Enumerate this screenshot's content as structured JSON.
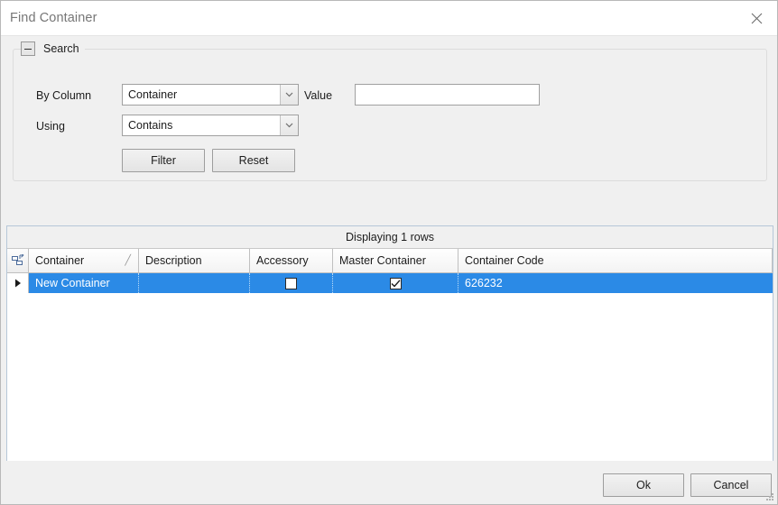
{
  "window": {
    "title": "Find Container",
    "close_label": "✕"
  },
  "search": {
    "group_title": "Search",
    "collapse_icon": "minus-icon",
    "by_column_label": "By Column",
    "by_column_value": "Container",
    "using_label": "Using",
    "using_value": "Contains",
    "value_label": "Value",
    "value_text": "",
    "value_placeholder": "",
    "filter_label": "Filter",
    "reset_label": "Reset"
  },
  "grid": {
    "caption": "Displaying 1 rows",
    "corner_icon": "grid-selector-icon",
    "sort_glyph": "╱",
    "columns": [
      {
        "label": "Container"
      },
      {
        "label": "Description"
      },
      {
        "label": "Accessory"
      },
      {
        "label": "Master Container"
      },
      {
        "label": "Container Code"
      }
    ],
    "rows": [
      {
        "indicator": "▶",
        "container": "New Container",
        "description": "",
        "accessory_checked": false,
        "master_container_checked": true,
        "container_code": "626232"
      }
    ]
  },
  "footer": {
    "ok_label": "Ok",
    "cancel_label": "Cancel"
  },
  "colors": {
    "selection_blue": "#2b8ae6",
    "panel_gray": "#f0f0f0",
    "grid_border": "#b6c7d8",
    "title_text": "#767676"
  }
}
